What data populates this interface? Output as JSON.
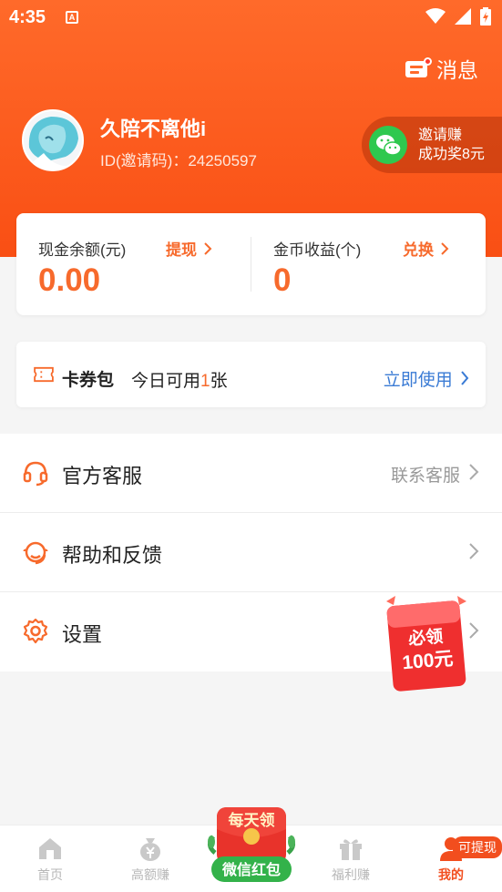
{
  "status_bar": {
    "time": "4:35",
    "notify_letter": "A"
  },
  "header": {
    "message_label": "消息",
    "username": "久陪不离他i",
    "user_id": "ID(邀请码)：24250597",
    "invite": {
      "line1": "邀请赚",
      "line2": "成功奖8元"
    }
  },
  "balance": {
    "cash_label": "现金余额(元)",
    "cash_action": "提现",
    "cash_value": "0.00",
    "coin_label": "金币收益(个)",
    "coin_action": "兑换",
    "coin_value": "0"
  },
  "coupon": {
    "title": "卡券包",
    "desc_prefix": "今日可用",
    "desc_count": "1",
    "desc_suffix": "张",
    "action": "立即使用"
  },
  "menu": {
    "items": [
      {
        "label": "官方客服",
        "right": "联系客服",
        "icon": "headset-icon"
      },
      {
        "label": "帮助和反馈",
        "right": "",
        "icon": "support-agent-icon"
      },
      {
        "label": "设置",
        "right": "",
        "icon": "gear-icon"
      }
    ]
  },
  "redpack_float": {
    "line1": "必领",
    "line2": "100元"
  },
  "tabbar": {
    "tabs": [
      {
        "label": "首页",
        "icon": "home-icon"
      },
      {
        "label": "高额赚",
        "icon": "money-bag-icon"
      },
      {
        "label": "微信红包",
        "icon": "red-envelope-icon"
      },
      {
        "label": "福利赚",
        "icon": "gift-icon"
      },
      {
        "label": "我的",
        "icon": "user-icon"
      }
    ],
    "center_top_text": "每天领",
    "badge": "可提现"
  },
  "colors": {
    "accent": "#f76a2c",
    "header": "#ff6a2a",
    "link": "#3a7bd5"
  }
}
